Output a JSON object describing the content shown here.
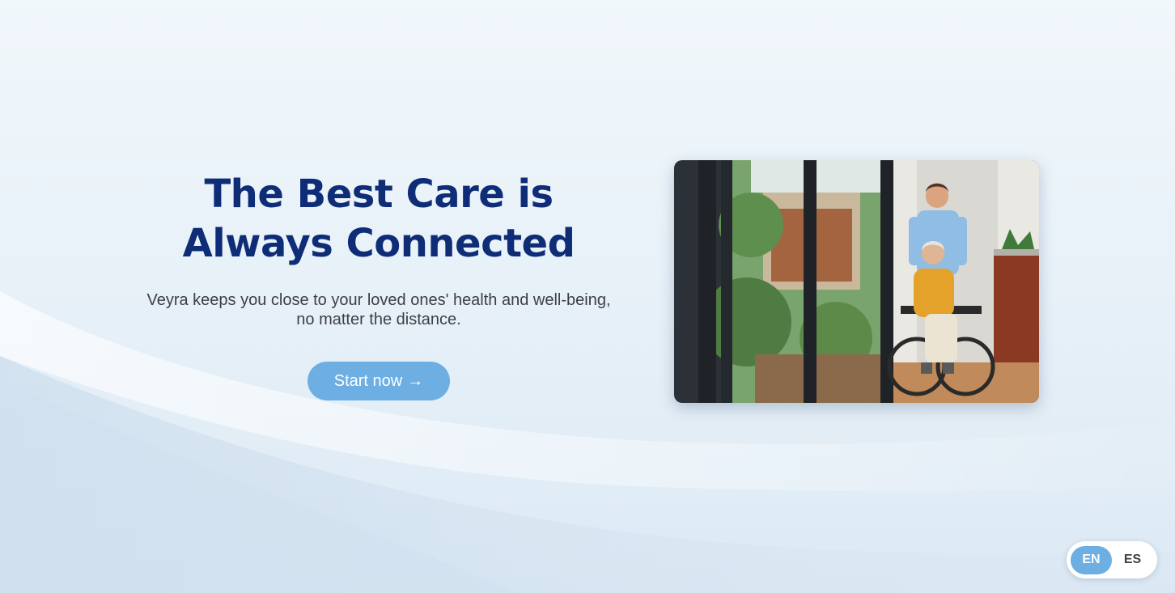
{
  "hero": {
    "title_line1": "The Best Care is",
    "title_line2": "Always Connected",
    "subtitle_line1": "Veyra keeps you close to your loved ones' health and well-being,",
    "subtitle_line2": "no matter the distance.",
    "cta_label": "Start now",
    "cta_icon": "→"
  },
  "photo": {
    "description_icon": "caregiver-wheelchair-photo"
  },
  "language": {
    "options": [
      {
        "label": "EN",
        "active": true
      },
      {
        "label": "ES",
        "active": false
      }
    ]
  },
  "colors": {
    "title": "#0f2d77",
    "accent": "#6daee3",
    "body_text": "#3c3f44"
  }
}
